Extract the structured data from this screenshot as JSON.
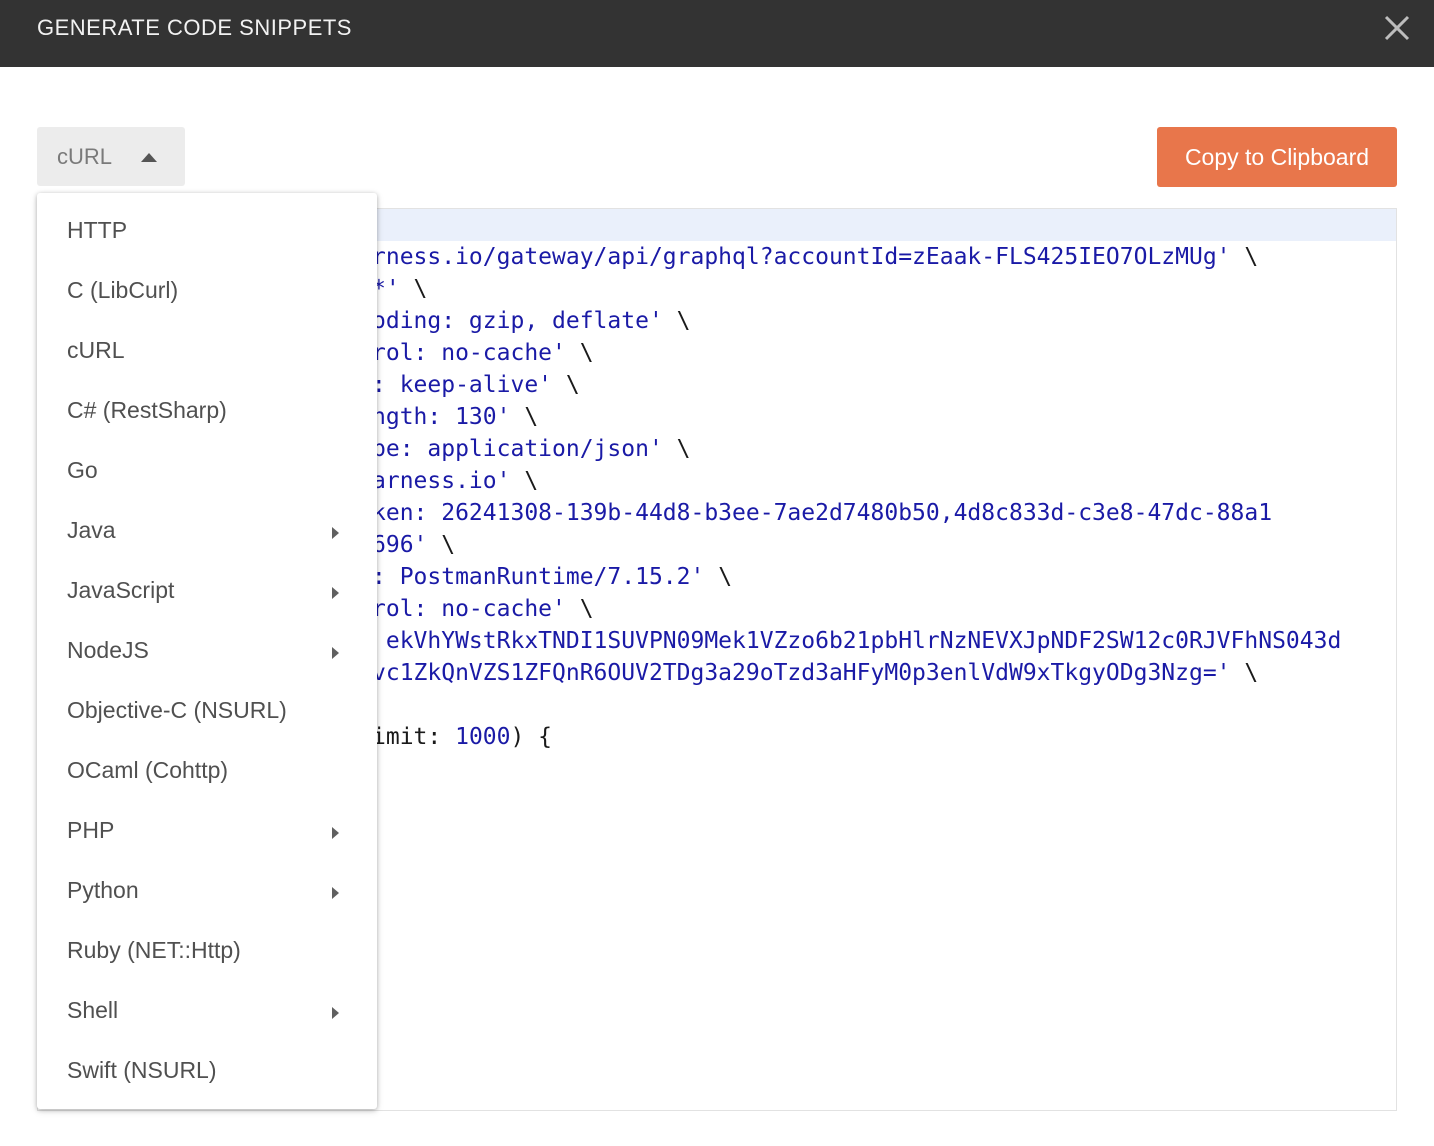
{
  "dialog": {
    "title": "GENERATE CODE SNIPPETS",
    "close_icon": "close-icon"
  },
  "language_select": {
    "selected": "cURL",
    "caret_icon": "caret-up-icon"
  },
  "copy_button": {
    "label": "Copy to Clipboard",
    "color": "#e8764b"
  },
  "code": {
    "lines": [
      {
        "text": "rness.io/gateway/api/graphql?accountId=zEaak-FLS425IEO7OLzMUg'",
        "suffix": " \\"
      },
      {
        "text": "*'",
        "suffix": " \\"
      },
      {
        "text": "oding: gzip, deflate'",
        "suffix": " \\"
      },
      {
        "text": "rol: no-cache'",
        "suffix": " \\"
      },
      {
        "text": ": keep-alive'",
        "suffix": " \\"
      },
      {
        "text": "ngth: 130'",
        "suffix": " \\"
      },
      {
        "text": "pe: application/json'",
        "suffix": " \\"
      },
      {
        "text": "arness.io'",
        "suffix": " \\"
      },
      {
        "text": "ken: 26241308-139b-44d8-b3ee-7ae2d7480b50,4d8c833d-c3e8-47dc-88a1",
        "suffix": ""
      },
      {
        "text": "696'",
        "suffix": " \\"
      },
      {
        "text": ": PostmanRuntime/7.15.2'",
        "suffix": " \\"
      },
      {
        "text": "rol: no-cache'",
        "suffix": " \\"
      },
      {
        "text": " ekVhYWstRkxTNDI1SUVPN09Mek1VZzo6b21pbHlrNzNEVXJpNDF2SW12c0RJVFhNS043d",
        "suffix": ""
      },
      {
        "text": "vc1ZkQnVZS1ZFQnR6OUV2TDg3a29oTzd3aHFyM0p3enlVdW9xTkgyODg3Nzg='",
        "suffix": " \\"
      }
    ],
    "query_line": {
      "before": "imit: ",
      "number": "1000",
      "after": ") {"
    }
  },
  "dropdown": {
    "items": [
      {
        "label": "HTTP",
        "submenu": false
      },
      {
        "label": "C (LibCurl)",
        "submenu": false
      },
      {
        "label": "cURL",
        "submenu": false
      },
      {
        "label": "C# (RestSharp)",
        "submenu": false
      },
      {
        "label": "Go",
        "submenu": false
      },
      {
        "label": "Java",
        "submenu": true
      },
      {
        "label": "JavaScript",
        "submenu": true
      },
      {
        "label": "NodeJS",
        "submenu": true
      },
      {
        "label": "Objective-C (NSURL)",
        "submenu": false
      },
      {
        "label": "OCaml (Cohttp)",
        "submenu": false
      },
      {
        "label": "PHP",
        "submenu": true
      },
      {
        "label": "Python",
        "submenu": true
      },
      {
        "label": "Ruby (NET::Http)",
        "submenu": false
      },
      {
        "label": "Shell",
        "submenu": true
      },
      {
        "label": "Swift (NSURL)",
        "submenu": false
      }
    ]
  }
}
